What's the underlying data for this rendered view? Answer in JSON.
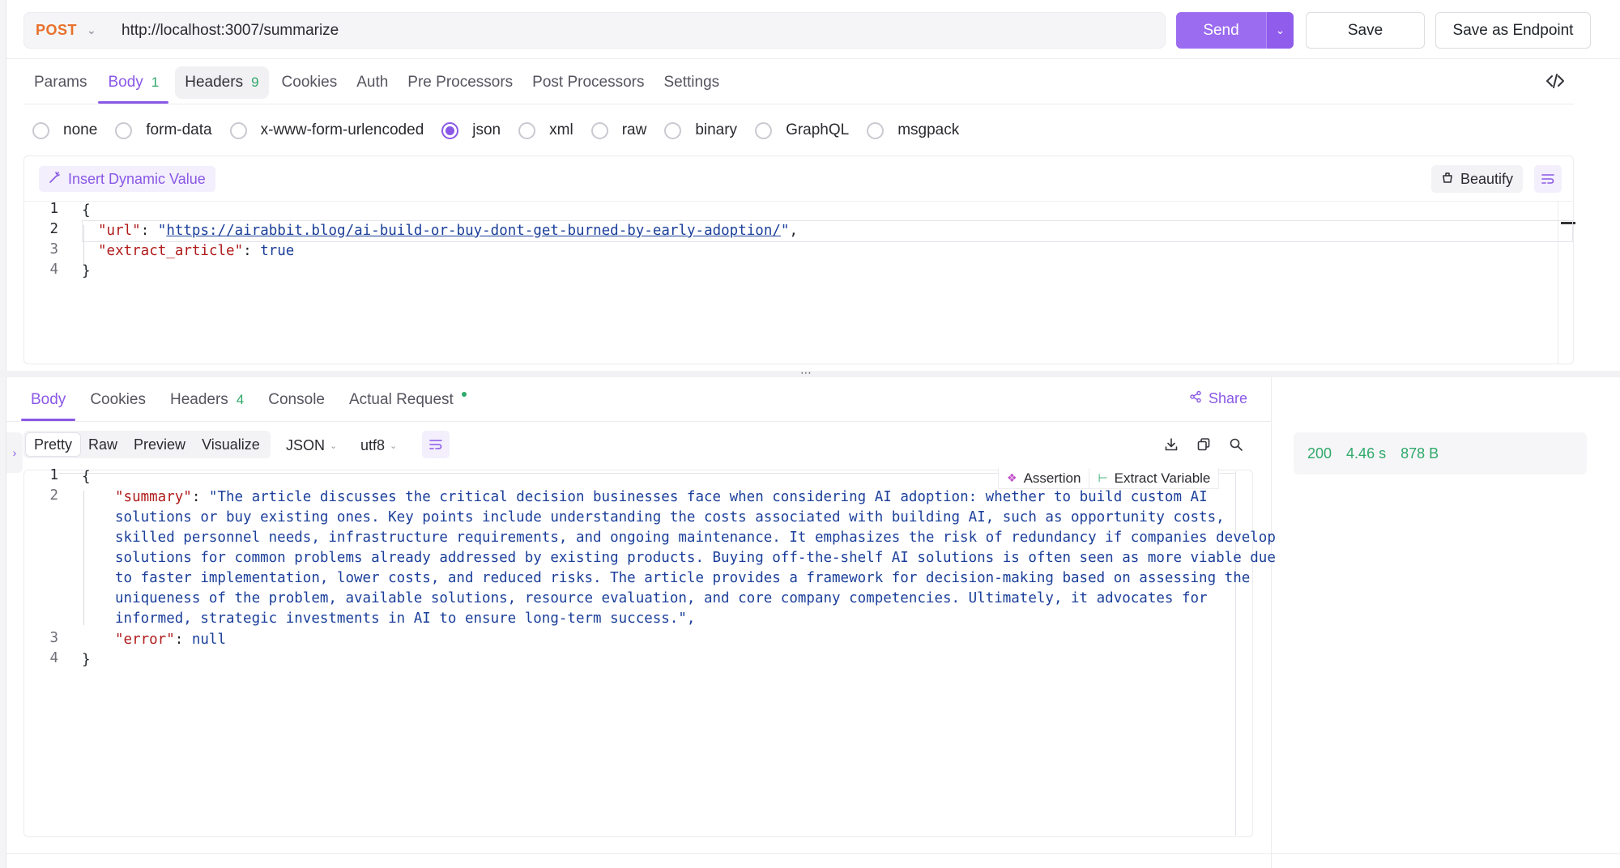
{
  "request": {
    "method": "POST",
    "url": "http://localhost:3007/summarize",
    "send_label": "Send",
    "save_label": "Save",
    "save_endpoint_label": "Save as Endpoint"
  },
  "request_tabs": [
    {
      "label": "Params",
      "count": ""
    },
    {
      "label": "Body",
      "count": "1"
    },
    {
      "label": "Headers",
      "count": "9"
    },
    {
      "label": "Cookies",
      "count": ""
    },
    {
      "label": "Auth",
      "count": ""
    },
    {
      "label": "Pre Processors",
      "count": ""
    },
    {
      "label": "Post Processors",
      "count": ""
    },
    {
      "label": "Settings",
      "count": ""
    }
  ],
  "body_types": [
    "none",
    "form-data",
    "x-www-form-urlencoded",
    "json",
    "xml",
    "raw",
    "binary",
    "GraphQL",
    "msgpack"
  ],
  "selected_body_type": "json",
  "request_editor": {
    "insert_dynamic_label": "Insert Dynamic Value",
    "beautify_label": "Beautify",
    "lines": {
      "l1": "{",
      "url_key": "\"url\"",
      "url_value": "https://airabbit.blog/ai-build-or-buy-dont-get-burned-by-early-adoption/",
      "extract_key": "\"extract_article\"",
      "extract_value": "true",
      "l4": "}"
    },
    "line_numbers": [
      "1",
      "2",
      "3",
      "4"
    ]
  },
  "response_tabs": [
    {
      "label": "Body",
      "count": ""
    },
    {
      "label": "Cookies",
      "count": ""
    },
    {
      "label": "Headers",
      "count": "4"
    },
    {
      "label": "Console",
      "count": ""
    },
    {
      "label": "Actual Request",
      "count": ""
    }
  ],
  "share_label": "Share",
  "view_modes": [
    "Pretty",
    "Raw",
    "Preview",
    "Visualize"
  ],
  "format_select": "JSON",
  "encoding_select": "utf8",
  "assertion_label": "Assertion",
  "extract_variable_label": "Extract Variable",
  "response_editor": {
    "line_numbers": [
      "1",
      "2",
      "3",
      "4"
    ],
    "open": "{",
    "summary_key": "\"summary\"",
    "summary_lines": [
      "\"The article discusses the critical decision businesses face when considering AI adoption: whether to build custom AI",
      "solutions or buy existing ones. Key points include understanding the costs associated with building AI, such as opportunity costs,",
      "skilled personnel needs, infrastructure requirements, and ongoing maintenance. It emphasizes the risk of redundancy if companies develop",
      "solutions for common problems already addressed by existing products. Buying off-the-shelf AI solutions is often seen as more viable due",
      "to faster implementation, lower costs, and reduced risks. The article provides a framework for decision-making based on assessing the",
      "uniqueness of the problem, available solutions, resource evaluation, and core company competencies. Ultimately, it advocates for",
      "informed, strategic investments in AI to ensure long-term success.\","
    ],
    "error_key": "\"error\"",
    "error_value": "null",
    "close": "}"
  },
  "status": {
    "code": "200",
    "time": "4.46 s",
    "size": "878 B"
  },
  "colors": {
    "accent": "#8a58e6",
    "send": "#9b6cf0",
    "method": "#e8702a",
    "success": "#2fa96a"
  }
}
